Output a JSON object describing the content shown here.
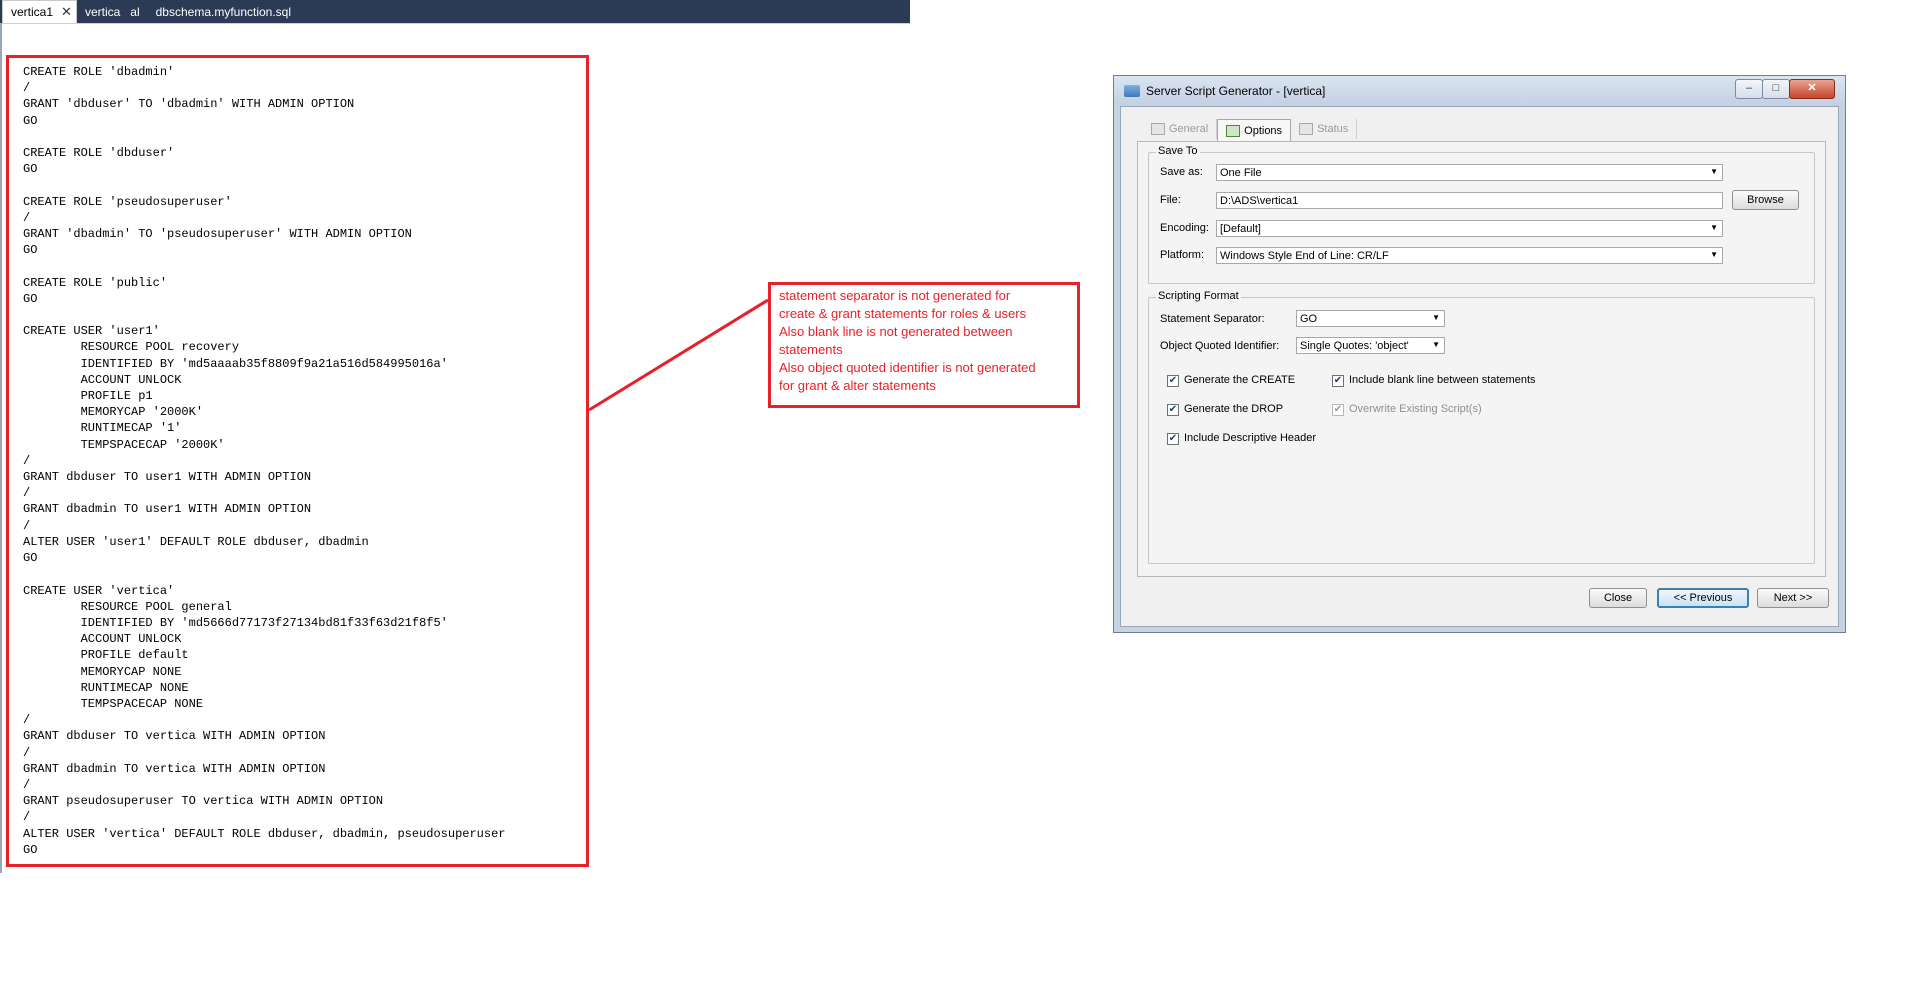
{
  "editor": {
    "tabs": [
      {
        "label": "vertica1",
        "active": true
      },
      {
        "label": "vertica   al"
      },
      {
        "label": "dbschema.myfunction.sql"
      }
    ],
    "close_glyph": "✕",
    "code": "CREATE ROLE 'dbadmin'\n/\nGRANT 'dbduser' TO 'dbadmin' WITH ADMIN OPTION\nGO\n\nCREATE ROLE 'dbduser'\nGO\n\nCREATE ROLE 'pseudosuperuser'\n/\nGRANT 'dbadmin' TO 'pseudosuperuser' WITH ADMIN OPTION\nGO\n\nCREATE ROLE 'public'\nGO\n\nCREATE USER 'user1'\n        RESOURCE POOL recovery\n        IDENTIFIED BY 'md5aaaab35f8809f9a21a516d584995016a'\n        ACCOUNT UNLOCK\n        PROFILE p1\n        MEMORYCAP '2000K'\n        RUNTIMECAP '1'\n        TEMPSPACECAP '2000K'\n/\nGRANT dbduser TO user1 WITH ADMIN OPTION\n/\nGRANT dbadmin TO user1 WITH ADMIN OPTION\n/\nALTER USER 'user1' DEFAULT ROLE dbduser, dbadmin\nGO\n\nCREATE USER 'vertica'\n        RESOURCE POOL general\n        IDENTIFIED BY 'md5666d77173f27134bd81f33f63d21f8f5'\n        ACCOUNT UNLOCK\n        PROFILE default\n        MEMORYCAP NONE\n        RUNTIMECAP NONE\n        TEMPSPACECAP NONE\n/\nGRANT dbduser TO vertica WITH ADMIN OPTION\n/\nGRANT dbadmin TO vertica WITH ADMIN OPTION\n/\nGRANT pseudosuperuser TO vertica WITH ADMIN OPTION\n/\nALTER USER 'vertica' DEFAULT ROLE dbduser, dbadmin, pseudosuperuser\nGO"
  },
  "annotation": {
    "lines": [
      "statement separator is not generated for",
      "create & grant statements for roles & users",
      "Also blank line is not generated between",
      "statements",
      "Also object quoted identifier is not generated",
      "for grant & alter statements"
    ],
    "color": "#e8202a"
  },
  "dialog": {
    "title": "Server Script Generator - [vertica]",
    "window_buttons": {
      "minimize": "‒",
      "maximize": "□",
      "close": "✕"
    },
    "tabs": [
      {
        "label": "General",
        "enabled": false
      },
      {
        "label": "Options",
        "selected": true
      },
      {
        "label": "Status",
        "enabled": false
      }
    ],
    "save_to": {
      "group_label": "Save To",
      "save_as_label": "Save as:",
      "save_as_value": "One File",
      "file_label": "File:",
      "file_value": "D:\\ADS\\vertica1",
      "browse_label": "Browse",
      "encoding_label": "Encoding:",
      "encoding_value": "[Default]",
      "platform_label": "Platform:",
      "platform_value": "Windows Style End of Line: CR/LF"
    },
    "scripting_format": {
      "group_label": "Scripting Format",
      "separator_label": "Statement Separator:",
      "separator_value": "GO",
      "quoted_label": "Object Quoted Identifier:",
      "quoted_value": "Single Quotes: 'object'",
      "checkboxes": {
        "generate_create": {
          "label": "Generate the CREATE",
          "checked": true
        },
        "generate_drop": {
          "label": "Generate the DROP",
          "checked": true
        },
        "descriptive_header": {
          "label": "Include Descriptive Header",
          "checked": true
        },
        "blank_line": {
          "label": "Include blank line between statements",
          "checked": true
        },
        "overwrite": {
          "label": "Overwrite Existing Script(s)",
          "checked": true,
          "enabled": false
        }
      }
    },
    "buttons": {
      "close": "Close",
      "previous": "<< Previous",
      "next": "Next >>"
    },
    "dropdown_glyph": "▼",
    "check_glyph": "✔"
  }
}
